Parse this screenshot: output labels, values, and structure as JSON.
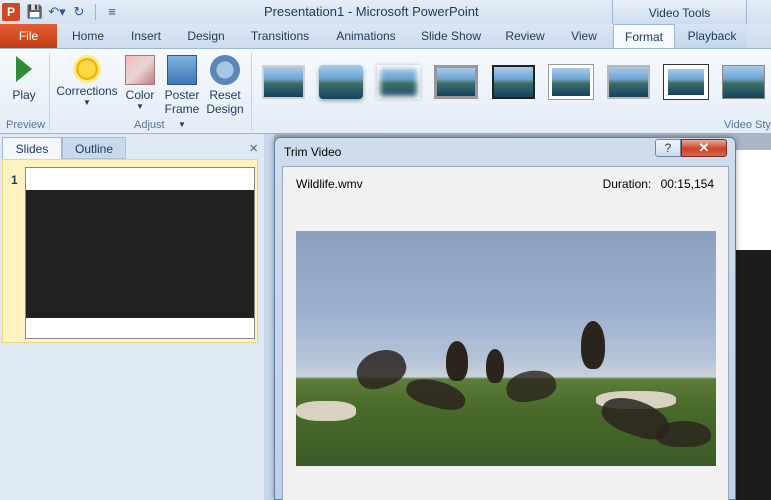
{
  "titlebar": {
    "title": "Presentation1 - Microsoft PowerPoint",
    "contextual_group": "Video Tools",
    "app_icon_letter": "P"
  },
  "tabs": {
    "file": "File",
    "items": [
      "Home",
      "Insert",
      "Design",
      "Transitions",
      "Animations",
      "Slide Show",
      "Review",
      "View"
    ],
    "format": "Format",
    "playback": "Playback"
  },
  "ribbon": {
    "preview": {
      "label": "Preview",
      "play": "Play"
    },
    "adjust": {
      "label": "Adjust",
      "corrections": "Corrections",
      "color": "Color",
      "poster_line1": "Poster",
      "poster_line2": "Frame",
      "reset_line1": "Reset",
      "reset_line2": "Design"
    },
    "video_styles_label": "Video Sty"
  },
  "panel": {
    "tab_slides": "Slides",
    "tab_outline": "Outline",
    "close": "×",
    "slide_number": "1"
  },
  "dialog": {
    "title": "Trim Video",
    "help": "?",
    "close": "✕",
    "filename": "Wildlife.wmv",
    "duration": "Duration: 00:15,154"
  }
}
